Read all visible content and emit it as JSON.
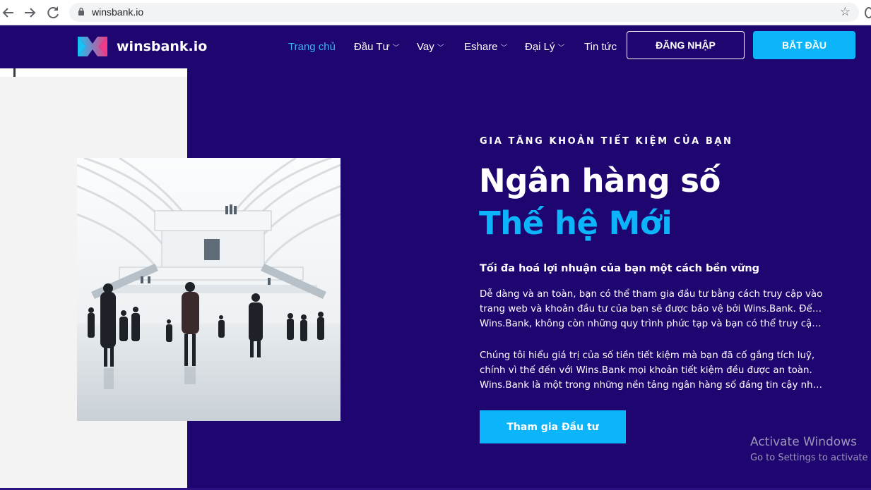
{
  "browser": {
    "url": "winsbank.io",
    "back_icon": "arrow-left-icon",
    "forward_icon": "arrow-right-icon",
    "reload_icon": "reload-icon",
    "lock_icon": "lock-icon",
    "bookmark_icon": "star-icon"
  },
  "header": {
    "logo_text": "winsbank.io",
    "menu": [
      {
        "label": "Trang chủ",
        "dropdown": false,
        "active": true
      },
      {
        "label": "Đầu Tư",
        "dropdown": true,
        "active": false
      },
      {
        "label": "Vay",
        "dropdown": true,
        "active": false
      },
      {
        "label": "Eshare",
        "dropdown": true,
        "active": false
      },
      {
        "label": "Đại Lý",
        "dropdown": true,
        "active": false
      },
      {
        "label": "Tin tức",
        "dropdown": false,
        "active": false
      }
    ],
    "login_label": "ĐĂNG NHẬP",
    "start_label": "BẮT ĐẦU"
  },
  "hero": {
    "eyebrow": "GIA TĂNG KHOẢN TIẾT KIỆM CỦA BẠN",
    "title_line1": "Ngân hàng số",
    "title_line2": "Thế hệ Mới",
    "subheading": "Tối đa hoá lợi nhuận của bạn một cách bền vững",
    "paragraph1": [
      "Dễ dàng và an toàn, bạn có thể tham gia đầu tư bằng cách truy cập vào",
      "trang web và khoản đầu tư của bạn sẽ được bảo vệ bởi Wins.Bank. Đến với",
      "Wins.Bank, không còn những quy trình phức tạp và bạn có thể truy cập t..."
    ],
    "paragraph2": [
      "Chúng tôi hiểu giá trị của số tiền tiết kiệm mà bạn đã cố gắng tích luỹ,",
      "chính vì thế đến với Wins.Bank mọi khoản tiết kiệm đều được an toàn.",
      "Wins.Bank là một trong những nền tảng ngân hàng số đáng tin cậy nhất..."
    ],
    "cta_label": "Tham gia Đầu tư"
  },
  "watermark": {
    "line1": "Activate Windows",
    "line2": "Go to Settings to activate"
  },
  "colors": {
    "background": "#1e0570",
    "accent": "#0cb4fa",
    "active_link": "#3ab3f4"
  }
}
